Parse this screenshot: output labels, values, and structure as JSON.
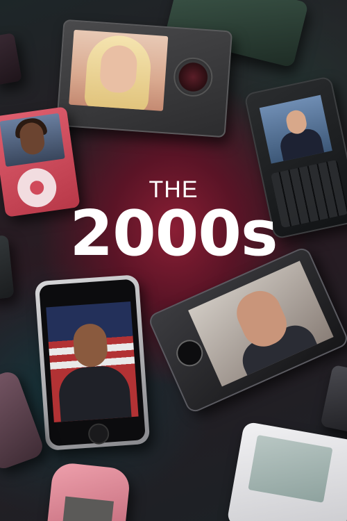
{
  "poster": {
    "title_line1": "THE",
    "title_line2": "2000s",
    "title_color": "#ffffff",
    "background_accent": "#8a1e34"
  },
  "devices": [
    {
      "name": "zune-player",
      "screen": "blonde-woman-portrait"
    },
    {
      "name": "ipod-nano-pink",
      "screen": "woman-portrait"
    },
    {
      "name": "blackberry-phone",
      "screen": "man-at-podium"
    },
    {
      "name": "iphone",
      "screen": "obama-speaking-flag"
    },
    {
      "name": "windows-mobile-phone",
      "screen": "man-in-suit"
    },
    {
      "name": "ipod-classic",
      "screen": "menu-screen"
    },
    {
      "name": "nokia-phone",
      "screen": "blank-screen"
    }
  ]
}
